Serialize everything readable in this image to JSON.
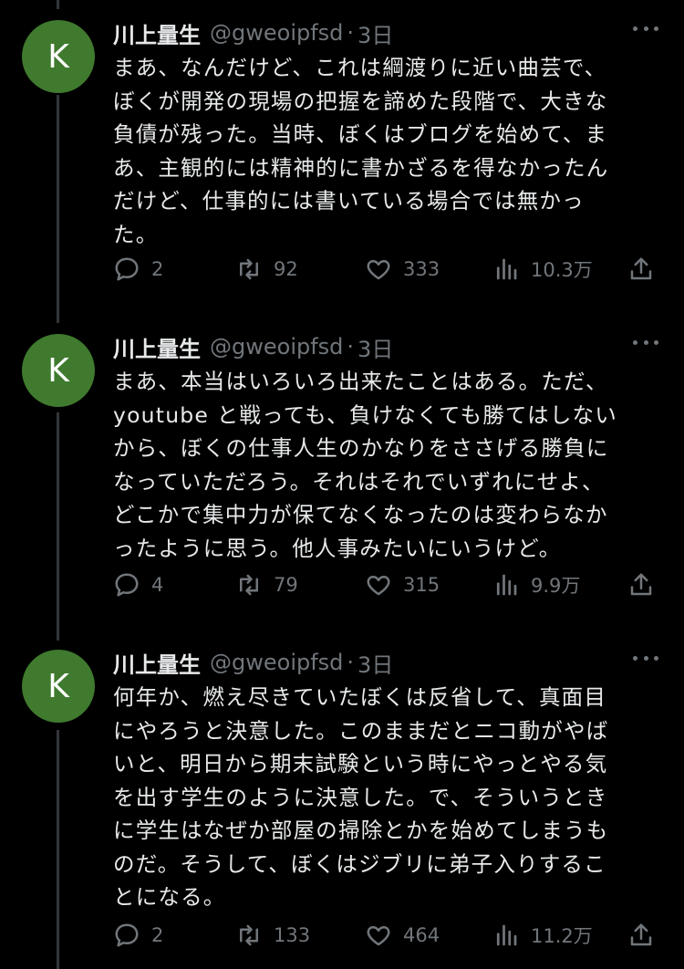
{
  "tweets": [
    {
      "avatar_letter": "K",
      "name": "川上量生",
      "handle": "@gweoipfsd",
      "separator": "·",
      "date": "3日",
      "lines": [
        "まあ、なんだけど、これは綱渡りに近い曲芸で、",
        "ぼくが開発の現場の把握を諦めた段階で、大きな",
        "負債が残った。当時、ぼくはブログを始めて、ま",
        "あ、主観的には精神的に書かざるを得なかったん",
        "だけど、仕事的には書いている場合では無かっ",
        "た。"
      ],
      "replies": "2",
      "retweets": "92",
      "likes": "333",
      "views": "10.3万"
    },
    {
      "avatar_letter": "K",
      "name": "川上量生",
      "handle": "@gweoipfsd",
      "separator": "·",
      "date": "3日",
      "lines": [
        "まあ、本当はいろいろ出来たことはある。ただ、",
        "youtube と戦っても、負けなくても勝てはしない",
        "から、ぼくの仕事人生のかなりをささげる勝負に",
        "なっていただろう。それはそれでいずれにせよ、",
        "どこかで集中力が保てなくなったのは変わらなか",
        "ったように思う。他人事みたいにいうけど。"
      ],
      "replies": "4",
      "retweets": "79",
      "likes": "315",
      "views": "9.9万"
    },
    {
      "avatar_letter": "K",
      "name": "川上量生",
      "handle": "@gweoipfsd",
      "separator": "·",
      "date": "3日",
      "lines": [
        "何年か、燃え尽きていたぼくは反省して、真面目",
        "にやろうと決意した。このままだとニコ動がやば",
        "いと、明日から期末試験という時にやっとやる気",
        "を出す学生のように決意した。で、そういうとき",
        "に学生はなぜか部屋の掃除とかを始めてしまうも",
        "のだ。そうして、ぼくはジブリに弟子入りするこ",
        "とになる。"
      ],
      "replies": "2",
      "retweets": "133",
      "likes": "464",
      "views": "11.2万"
    }
  ],
  "icons": {
    "reply": "reply-icon",
    "retweet": "retweet-icon",
    "like": "like-icon",
    "views": "views-icon",
    "share": "share-icon",
    "more": "more-icon"
  },
  "colors": {
    "background": "#000000",
    "text": "#e7e9ea",
    "muted": "#71767b",
    "avatar": "#3f7a2e",
    "thread_line": "#333639"
  }
}
